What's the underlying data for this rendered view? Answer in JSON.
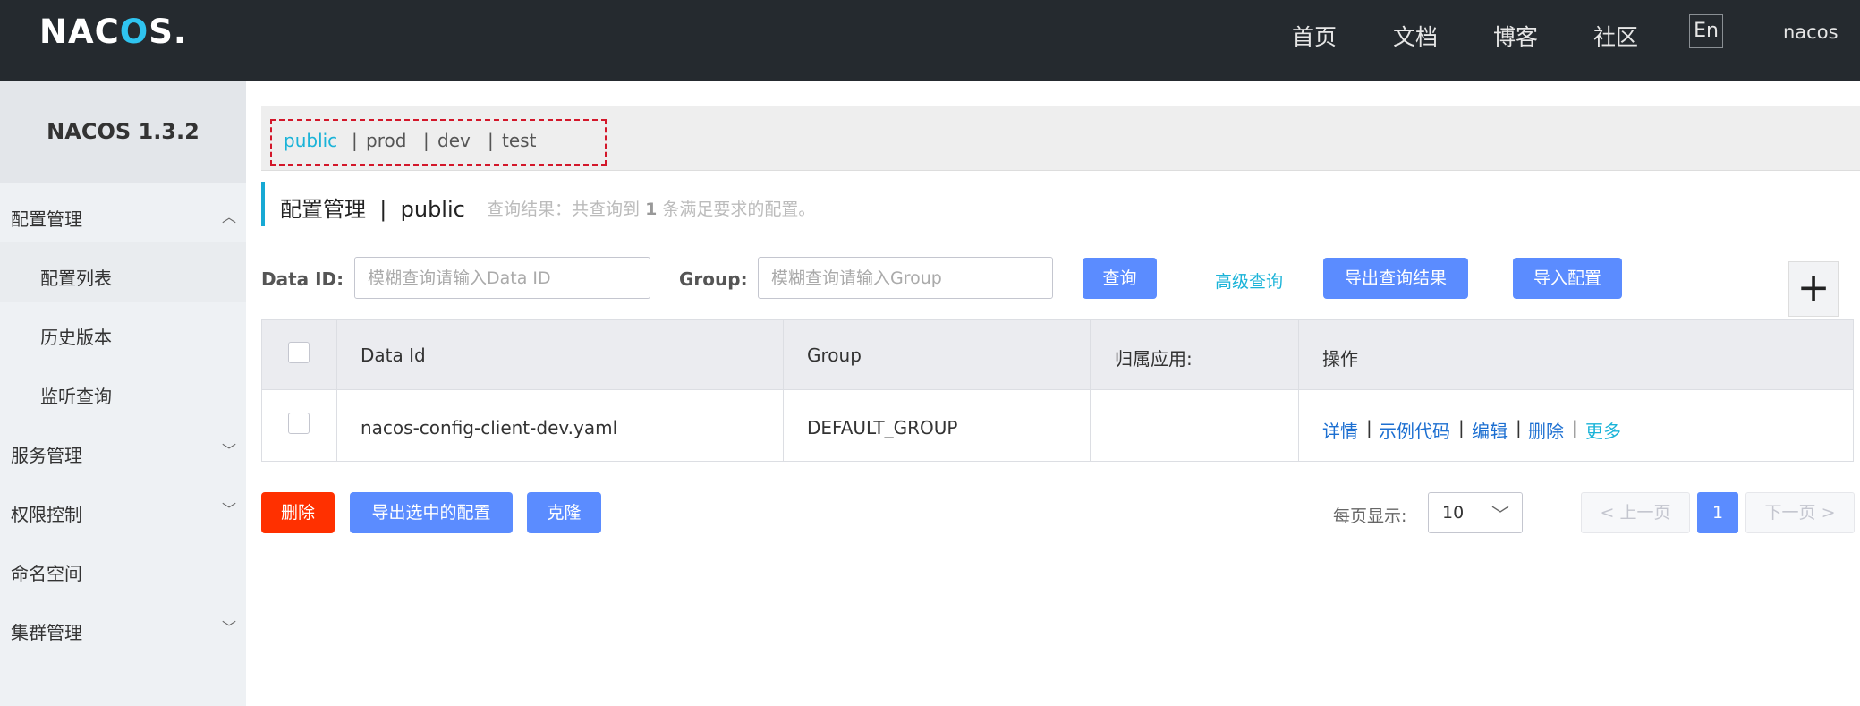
{
  "header": {
    "logo": "NACOS.",
    "nav": [
      "首页",
      "文档",
      "博客",
      "社区"
    ],
    "lang": "En",
    "user": "nacos"
  },
  "sidebar": {
    "title": "NACOS 1.3.2",
    "groups": [
      {
        "label": "配置管理",
        "expanded": true,
        "items": [
          "配置列表",
          "历史版本",
          "监听查询"
        ]
      },
      {
        "label": "服务管理",
        "expanded": false
      },
      {
        "label": "权限控制",
        "expanded": false
      },
      {
        "label": "命名空间"
      },
      {
        "label": "集群管理",
        "expanded": false
      }
    ]
  },
  "namespaces": {
    "items": [
      "public",
      "prod",
      "dev",
      "test"
    ],
    "active": "public",
    "separator": "|"
  },
  "page": {
    "title": "配置管理",
    "title_sep": "|",
    "namespace": "public",
    "query_prefix": "查询结果：共查询到",
    "query_count": "1",
    "query_suffix": "条满足要求的配置。"
  },
  "search": {
    "dataid_label": "Data ID:",
    "dataid_placeholder": "模糊查询请输入Data ID",
    "group_label": "Group:",
    "group_placeholder": "模糊查询请输入Group",
    "query_button": "查询",
    "advanced_link": "高级查询",
    "export_button": "导出查询结果",
    "import_button": "导入配置",
    "add_symbol": "+"
  },
  "table": {
    "columns": [
      "Data Id",
      "Group",
      "归属应用:",
      "操作"
    ],
    "rows": [
      {
        "data_id": "nacos-config-client-dev.yaml",
        "group": "DEFAULT_GROUP",
        "app": ""
      }
    ],
    "actions": [
      "详情",
      "示例代码",
      "编辑",
      "删除",
      "更多"
    ],
    "action_sep": "|"
  },
  "footer": {
    "delete_button": "删除",
    "export_selected_button": "导出选中的配置",
    "clone_button": "克隆",
    "per_page_label": "每页显示:",
    "per_page_value": "10",
    "prev": "上一页",
    "next": "下一页",
    "current_page": "1"
  },
  "colors": {
    "header_bg": "#252a2f",
    "primary": "#5b8cff",
    "danger": "#ff3000",
    "accent": "#1ab3d8",
    "link": "#1c6fd1",
    "highlight_box": "#d3172a"
  }
}
